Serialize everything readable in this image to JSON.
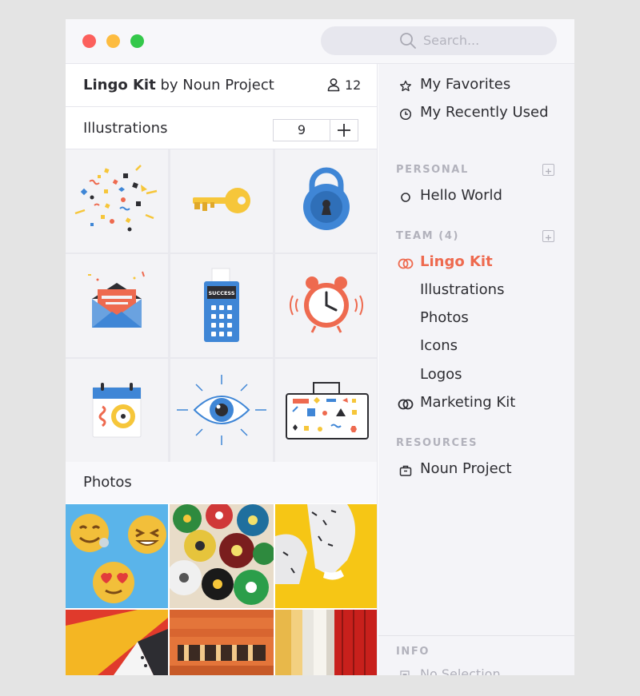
{
  "window": {
    "search_placeholder": "Search..."
  },
  "kit": {
    "name": "Lingo Kit",
    "by_text": "by Noun Project",
    "member_count": "12"
  },
  "illustrations": {
    "label": "Illustrations",
    "count": "9",
    "items": [
      "confetti",
      "key",
      "padlock",
      "envelope",
      "payment-terminal",
      "alarm-clock",
      "calendar",
      "eye",
      "toolbox"
    ],
    "terminal_text": "SUCCESS"
  },
  "photos": {
    "label": "Photos",
    "items": [
      "emoji-cookies",
      "vinyl-records",
      "dancer-on-yellow",
      "paper-shapes",
      "orange-building",
      "stage-curtains"
    ]
  },
  "sidebar": {
    "favorites": "My Favorites",
    "recent": "My Recently Used",
    "personal_header": "PERSONAL",
    "personal_items": [
      "Hello World"
    ],
    "team_header": "TEAM (4)",
    "active_kit": "Lingo Kit",
    "kit_sections": [
      "Illustrations",
      "Photos",
      "Icons",
      "Logos"
    ],
    "other_kit": "Marketing Kit",
    "resources_header": "RESOURCES",
    "resources_items": [
      "Noun Project"
    ],
    "info_header": "INFO",
    "info_text": "No Selection"
  },
  "colors": {
    "accent": "#ee6a4f",
    "close": "#fc605c",
    "minimize": "#fdbc40",
    "zoom": "#34c84a",
    "blue": "#3f86d6",
    "yellow": "#f6c63a"
  }
}
